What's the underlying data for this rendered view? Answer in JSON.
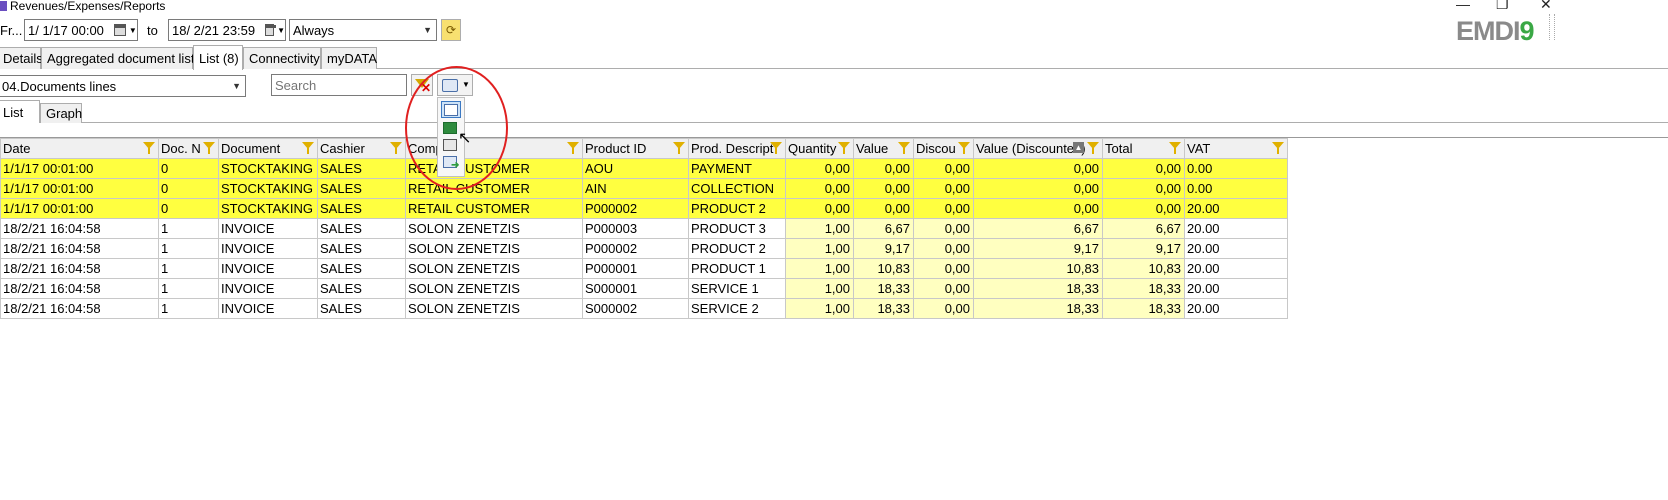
{
  "window": {
    "title": "Revenues/Expenses/Reports"
  },
  "toolbar": {
    "from_label": "Fr...",
    "from_value": "1/  1/17 00:00",
    "to_label": "to",
    "to_value": "18/  2/21 23:59",
    "period_value": "Always"
  },
  "logo": {
    "text_a": "EMDI",
    "text_b": "9"
  },
  "tabs": [
    {
      "label": "Details"
    },
    {
      "label": "Aggregated document list"
    },
    {
      "label": "List (8)"
    },
    {
      "label": "Connectivity"
    },
    {
      "label": "myDATA"
    }
  ],
  "report": {
    "selected": "04.Documents lines",
    "search_placeholder": "Search"
  },
  "subtabs": [
    {
      "label": "List"
    },
    {
      "label": "Graph"
    }
  ],
  "grid": {
    "columns": [
      "Date",
      "Doc. N",
      "Document",
      "Cashier",
      "Comp",
      "Product ID",
      "Prod. Descript",
      "Quantity",
      "Value",
      "Discou",
      "Value (Discounted)",
      "Total",
      "VAT"
    ],
    "rows": [
      {
        "highlight": true,
        "cells": [
          "1/1/17 00:01:00",
          "0",
          "STOCKTAKING",
          "SALES",
          "RETAIL CUSTOMER",
          "AOU",
          "PAYMENT",
          "0,00",
          "0,00",
          "0,00",
          "0,00",
          "0,00",
          "0.00"
        ]
      },
      {
        "highlight": true,
        "cells": [
          "1/1/17 00:01:00",
          "0",
          "STOCKTAKING",
          "SALES",
          "RETAIL CUSTOMER",
          "AIN",
          "COLLECTION",
          "0,00",
          "0,00",
          "0,00",
          "0,00",
          "0,00",
          "0.00"
        ]
      },
      {
        "highlight": true,
        "cells": [
          "1/1/17 00:01:00",
          "0",
          "STOCKTAKING",
          "SALES",
          "RETAIL CUSTOMER",
          "P000002",
          "PRODUCT 2",
          "0,00",
          "0,00",
          "0,00",
          "0,00",
          "0,00",
          "20.00"
        ]
      },
      {
        "highlight": false,
        "cells": [
          "18/2/21 16:04:58",
          "1",
          "INVOICE",
          "SALES",
          "SOLON ZENETZIS",
          "P000003",
          "PRODUCT 3",
          "1,00",
          "6,67",
          "0,00",
          "6,67",
          "6,67",
          "20.00"
        ]
      },
      {
        "highlight": false,
        "cells": [
          "18/2/21 16:04:58",
          "1",
          "INVOICE",
          "SALES",
          "SOLON ZENETZIS",
          "P000002",
          "PRODUCT 2",
          "1,00",
          "9,17",
          "0,00",
          "9,17",
          "9,17",
          "20.00"
        ]
      },
      {
        "highlight": false,
        "cells": [
          "18/2/21 16:04:58",
          "1",
          "INVOICE",
          "SALES",
          "SOLON ZENETZIS",
          "P000001",
          "PRODUCT 1",
          "1,00",
          "10,83",
          "0,00",
          "10,83",
          "10,83",
          "20.00"
        ]
      },
      {
        "highlight": false,
        "cells": [
          "18/2/21 16:04:58",
          "1",
          "INVOICE",
          "SALES",
          "SOLON ZENETZIS",
          "S000001",
          "SERVICE 1",
          "1,00",
          "18,33",
          "0,00",
          "18,33",
          "18,33",
          "20.00"
        ]
      },
      {
        "highlight": false,
        "cells": [
          "18/2/21 16:04:58",
          "1",
          "INVOICE",
          "SALES",
          "SOLON ZENETZIS",
          "S000002",
          "SERVICE 2",
          "1,00",
          "18,33",
          "0,00",
          "18,33",
          "18,33",
          "20.00"
        ]
      }
    ]
  },
  "colors": {
    "highlight_row": "#ffff40",
    "numeric_cell": "#ffffc0",
    "annotation": "#e02020",
    "logo_gray": "#8a8a8a",
    "logo_green": "#3aa845"
  }
}
